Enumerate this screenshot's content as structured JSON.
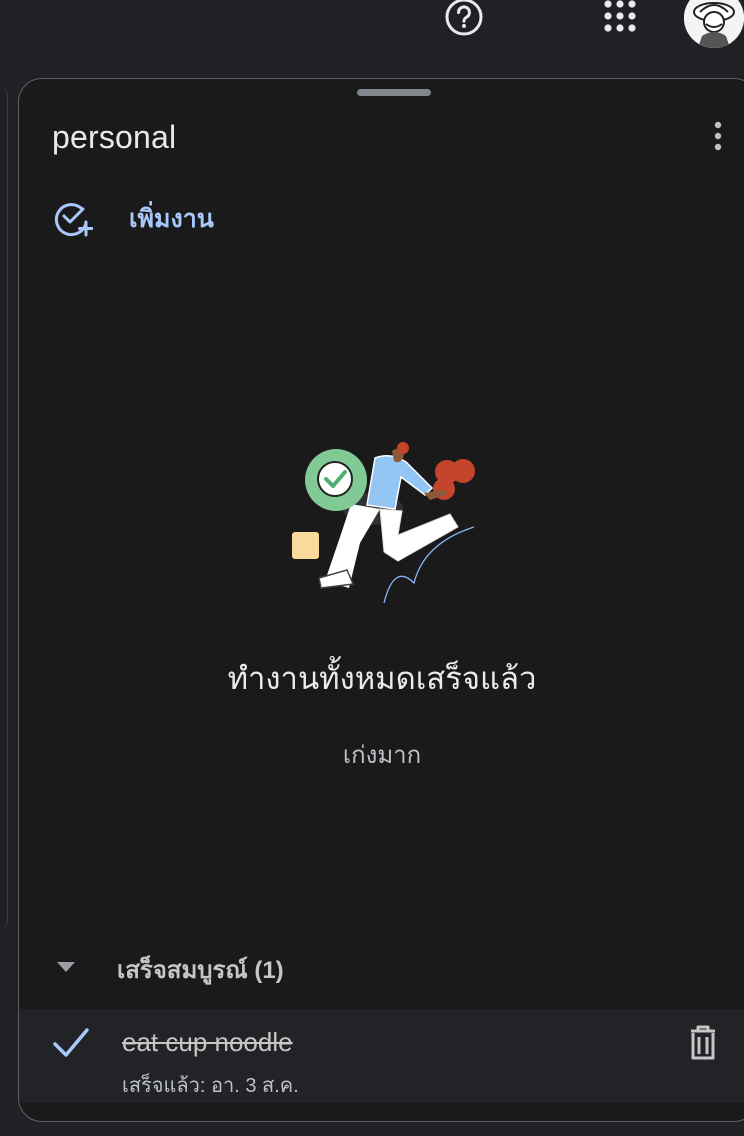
{
  "topbar": {
    "help_icon": "help-circle-icon",
    "apps_icon": "apps-grid-icon",
    "avatar_icon": "user-avatar"
  },
  "list": {
    "title": "personal",
    "menu_icon": "more-vert-icon",
    "add_task_label": "เพิ่มงาน",
    "add_task_icon": "add-task-icon"
  },
  "empty_state": {
    "title": "ทำงานทั้งหมดเสร็จแล้ว",
    "subtitle": "เก่งมาก"
  },
  "completed": {
    "header_label": "เสร็จสมบูรณ์ (1)",
    "items": [
      {
        "title": "eat cup noodle",
        "meta": "เสร็จแล้ว: อา. 3 ส.ค."
      }
    ]
  },
  "colors": {
    "accent": "#a8c7fa",
    "panel_bg": "#1a1a1b",
    "page_bg": "#202124"
  }
}
